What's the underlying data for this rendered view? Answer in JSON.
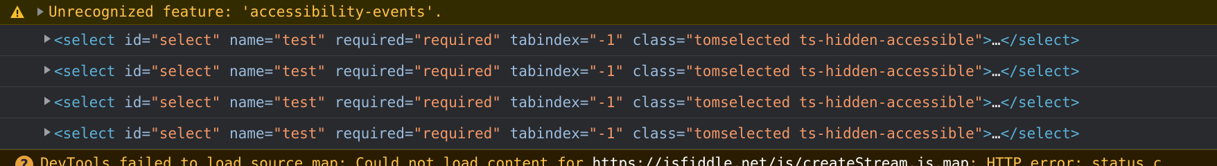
{
  "warning": {
    "message": "Unrecognized feature: 'accessibility-events'."
  },
  "elements": [
    {
      "open_tag": "<select",
      "attributes": [
        {
          "name": "id",
          "value": "\"select\""
        },
        {
          "name": "name",
          "value": "\"test\""
        },
        {
          "name": "required",
          "value": "\"required\""
        },
        {
          "name": "tabindex",
          "value": "\"-1\""
        },
        {
          "name": "class",
          "value": "\"tomselected ts-hidden-accessible\""
        }
      ],
      "gt": ">",
      "ellipsis": "…",
      "close_tag": "</select>"
    },
    {
      "open_tag": "<select",
      "attributes": [
        {
          "name": "id",
          "value": "\"select\""
        },
        {
          "name": "name",
          "value": "\"test\""
        },
        {
          "name": "required",
          "value": "\"required\""
        },
        {
          "name": "tabindex",
          "value": "\"-1\""
        },
        {
          "name": "class",
          "value": "\"tomselected ts-hidden-accessible\""
        }
      ],
      "gt": ">",
      "ellipsis": "…",
      "close_tag": "</select>"
    },
    {
      "open_tag": "<select",
      "attributes": [
        {
          "name": "id",
          "value": "\"select\""
        },
        {
          "name": "name",
          "value": "\"test\""
        },
        {
          "name": "required",
          "value": "\"required\""
        },
        {
          "name": "tabindex",
          "value": "\"-1\""
        },
        {
          "name": "class",
          "value": "\"tomselected ts-hidden-accessible\""
        }
      ],
      "gt": ">",
      "ellipsis": "…",
      "close_tag": "</select>"
    },
    {
      "open_tag": "<select",
      "attributes": [
        {
          "name": "id",
          "value": "\"select\""
        },
        {
          "name": "name",
          "value": "\"test\""
        },
        {
          "name": "required",
          "value": "\"required\""
        },
        {
          "name": "tabindex",
          "value": "\"-1\""
        },
        {
          "name": "class",
          "value": "\"tomselected ts-hidden-accessible\""
        }
      ],
      "gt": ">",
      "ellipsis": "…",
      "close_tag": "</select>"
    }
  ],
  "error": {
    "icon_glyph": "?",
    "message_prefix": "DevTools failed to load source map: Could not load content for ",
    "url": "https://jsfiddle.net/js/createStream.js.map",
    "message_suffix": ": HTTP error: status c"
  },
  "colors": {
    "background": "#282a2e",
    "warning_background": "#332b00",
    "warning_text": "#ffc24d",
    "tag": "#5db0d7",
    "attribute_name": "#9bbbdc",
    "attribute_value": "#f29766"
  },
  "icons": {
    "warning": "warning-triangle-icon",
    "expand": "expand-triangle-icon",
    "error": "question-circle-icon"
  }
}
